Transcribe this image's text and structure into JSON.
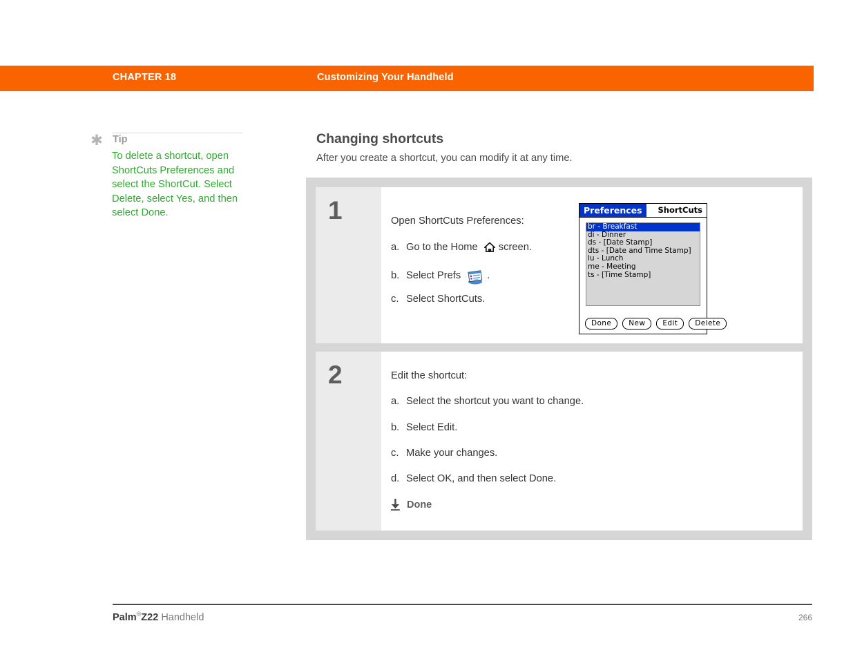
{
  "banner": {
    "chapter": "CHAPTER 18",
    "title": "Customizing Your Handheld",
    "color": "#fa6400"
  },
  "tip": {
    "icon": "asterisk-icon",
    "label": "Tip",
    "text": "To delete a shortcut, open ShortCuts Preferences and select the ShortCut. Select Delete, select Yes, and then select Done.",
    "color": "#2eab2e"
  },
  "section": {
    "heading": "Changing shortcuts",
    "intro": "After you create a shortcut, you can modify it at any time."
  },
  "steps": [
    {
      "number": "1",
      "lead": "Open ShortCuts Preferences:",
      "items": [
        {
          "letter": "a.",
          "before": "Go to the Home",
          "icon": "home-icon",
          "after": "screen."
        },
        {
          "letter": "b.",
          "before": "Select Prefs",
          "icon": "prefs-icon",
          "after": "."
        },
        {
          "letter": "c.",
          "before": "Select ShortCuts.",
          "icon": "",
          "after": ""
        }
      ]
    },
    {
      "number": "2",
      "lead": "Edit the shortcut:",
      "items": [
        {
          "letter": "a.",
          "before": "Select the shortcut you want to change.",
          "icon": "",
          "after": ""
        },
        {
          "letter": "b.",
          "before": "Select Edit.",
          "icon": "",
          "after": ""
        },
        {
          "letter": "c.",
          "before": "Make your changes.",
          "icon": "",
          "after": ""
        },
        {
          "letter": "d.",
          "before": "Select OK, and then select Done.",
          "icon": "",
          "after": ""
        }
      ],
      "done": {
        "icon": "down-arrow-done-icon",
        "label": "Done"
      }
    }
  ],
  "palm_screenshot": {
    "title_tab": "Preferences",
    "title_right": "ShortCuts",
    "list": [
      {
        "text": "br - Breakfast",
        "selected": true
      },
      {
        "text": "di - Dinner",
        "selected": false
      },
      {
        "text": "ds - [Date Stamp]",
        "selected": false
      },
      {
        "text": "dts - [Date and Time Stamp]",
        "selected": false
      },
      {
        "text": "lu - Lunch",
        "selected": false
      },
      {
        "text": "me - Meeting",
        "selected": false
      },
      {
        "text": "ts - [Time Stamp]",
        "selected": false
      }
    ],
    "buttons": [
      "Done",
      "New",
      "Edit",
      "Delete"
    ],
    "selection_color": "#0033cc"
  },
  "footer": {
    "brand": "Palm",
    "registered": "®",
    "model": "Z22",
    "product": " Handheld",
    "page": "266"
  }
}
